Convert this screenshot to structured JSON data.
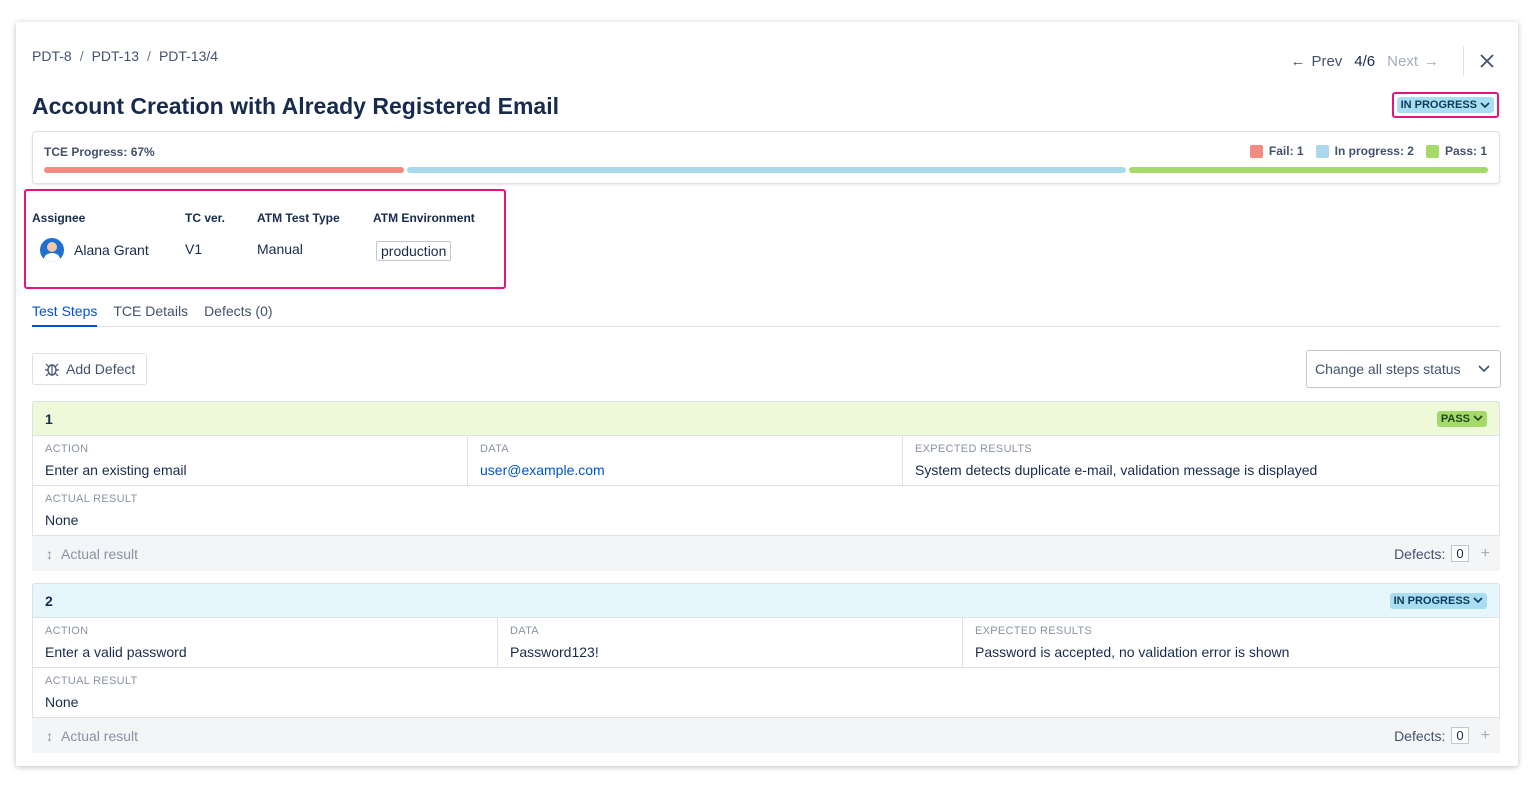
{
  "breadcrumb": [
    "PDT-8",
    "PDT-13",
    "PDT-13/4"
  ],
  "nav": {
    "prev_label": "Prev",
    "position": "4/6",
    "next_label": "Next"
  },
  "title": "Account Creation with Already Registered Email",
  "status": {
    "label": "IN PROGRESS",
    "color": "#a9def2"
  },
  "progress": {
    "label": "TCE Progress: 67%",
    "legend": [
      {
        "label": "Fail: 1",
        "color": "#f28b82"
      },
      {
        "label": "In progress: 2",
        "color": "#a9d8ec"
      },
      {
        "label": "Pass: 1",
        "color": "#a5d96a"
      }
    ],
    "segments": [
      {
        "name": "fail",
        "fraction": 0.25,
        "color": "#f28b82"
      },
      {
        "name": "in-progress",
        "fraction": 0.5,
        "color": "#a9d8ec"
      },
      {
        "name": "pass",
        "fraction": 0.25,
        "color": "#a5d96a"
      }
    ]
  },
  "info": {
    "assignee_label": "Assignee",
    "assignee": "Alana Grant",
    "tc_ver_label": "TC ver.",
    "tc_ver": "V1",
    "type_label": "ATM Test Type",
    "type": "Manual",
    "env_label": "ATM Environment",
    "env": "production"
  },
  "tabs": [
    "Test Steps",
    "TCE Details",
    "Defects (0)"
  ],
  "toolbar": {
    "add_defect": "Add Defect",
    "change_all": "Change all steps status"
  },
  "steps": [
    {
      "number": "1",
      "status": "PASS",
      "head_bg": "#eef9d9",
      "lozenge_bg": "#a5d96a",
      "lozenge_fg": "#1e4620",
      "action_label": "ACTION",
      "action": "Enter an existing email",
      "data_label": "DATA",
      "data": "user@example.com",
      "expected_label": "EXPECTED RESULTS",
      "expected": "System detects duplicate e-mail, validation message is displayed",
      "actual_label": "ACTUAL RESULT",
      "actual": "None",
      "actual_placeholder": "Actual result",
      "defects_label": "Defects:",
      "defects_count": "0"
    },
    {
      "number": "2",
      "status": "IN PROGRESS",
      "head_bg": "#e6f6fc",
      "lozenge_bg": "#a9def2",
      "lozenge_fg": "#0b3a5a",
      "action_label": "ACTION",
      "action": "Enter a valid password",
      "data_label": "DATA",
      "data": "Password123!",
      "expected_label": "EXPECTED RESULTS",
      "expected": "Password is accepted, no validation error is shown",
      "actual_label": "ACTUAL RESULT",
      "actual": "None",
      "actual_placeholder": "Actual result",
      "defects_label": "Defects:",
      "defects_count": "0"
    }
  ]
}
